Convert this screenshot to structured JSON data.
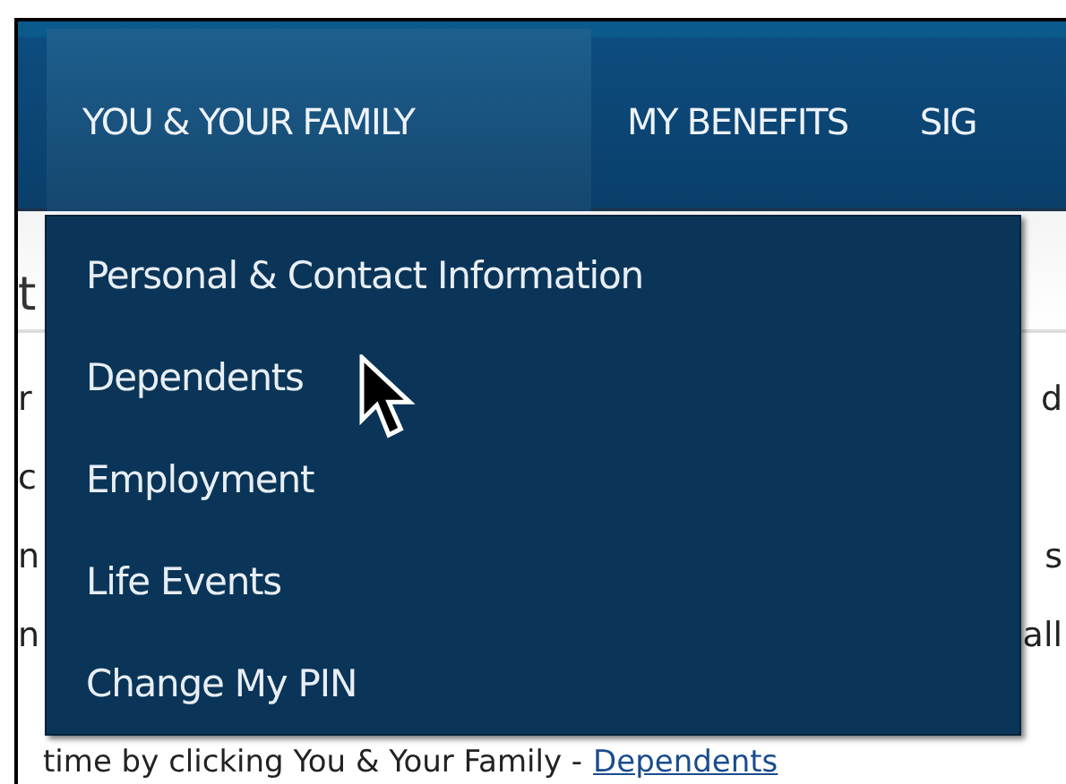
{
  "nav": {
    "tabs": [
      {
        "label": "YOU & YOUR FAMILY",
        "selected": true
      },
      {
        "label": "MY BENEFITS",
        "selected": false
      },
      {
        "label": "SIG",
        "selected": false
      }
    ]
  },
  "menu": {
    "items": [
      "Personal & Contact Information",
      "Dependents",
      "Employment",
      "Life Events",
      "Change My PIN"
    ]
  },
  "page": {
    "heading": "t",
    "lines": [
      {
        "left": "r",
        "right": "d"
      },
      {
        "left": "c"
      },
      {
        "left": "n",
        "right": "s"
      },
      {
        "left": "n",
        "right": "all"
      }
    ],
    "footer_text": "time by clicking You & Your Family -",
    "footer_link": "Dependents"
  }
}
